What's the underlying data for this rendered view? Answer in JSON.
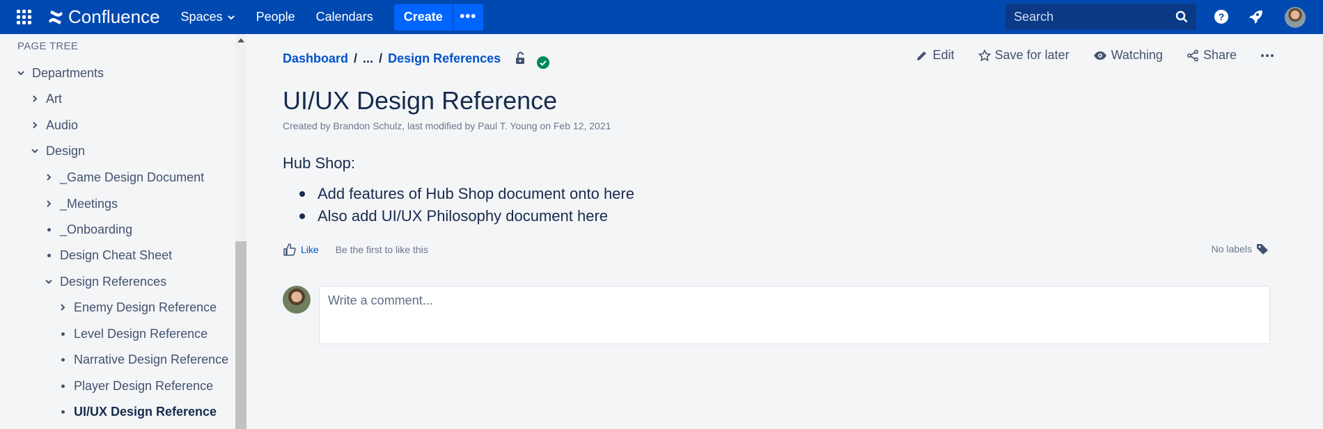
{
  "topnav": {
    "logo_text": "Confluence",
    "spaces_label": "Spaces",
    "people_label": "People",
    "calendars_label": "Calendars",
    "create_label": "Create",
    "more_label": "•••",
    "search_placeholder": "Search"
  },
  "sidebar": {
    "heading": "PAGE TREE",
    "items": [
      {
        "label": "Departments",
        "marker": "chevron-down"
      },
      {
        "label": "Art",
        "marker": "chevron-right"
      },
      {
        "label": "Audio",
        "marker": "chevron-right"
      },
      {
        "label": "Design",
        "marker": "chevron-down"
      },
      {
        "label": "_Game Design Document",
        "marker": "chevron-right"
      },
      {
        "label": "_Meetings",
        "marker": "chevron-right"
      },
      {
        "label": "_Onboarding",
        "marker": "bullet"
      },
      {
        "label": "Design Cheat Sheet",
        "marker": "bullet"
      },
      {
        "label": "Design References",
        "marker": "chevron-down"
      },
      {
        "label": "Enemy Design Reference",
        "marker": "chevron-right"
      },
      {
        "label": "Level Design Reference",
        "marker": "bullet"
      },
      {
        "label": "Narrative Design Reference",
        "marker": "bullet"
      },
      {
        "label": "Player Design Reference",
        "marker": "bullet"
      },
      {
        "label": "UI/UX Design Reference",
        "marker": "bullet",
        "current": true
      }
    ]
  },
  "breadcrumb": {
    "root": "Dashboard",
    "ellipsis": "...",
    "separator": "/",
    "parent": "Design References"
  },
  "actions": {
    "edit": "Edit",
    "save_for_later": "Save for later",
    "watching": "Watching",
    "share": "Share"
  },
  "page": {
    "title": "UI/UX Design Reference",
    "byline": "Created by Brandon Schulz, last modified by Paul T. Young on Feb 12, 2021",
    "section_heading": "Hub Shop:",
    "bullets": [
      "Add features of Hub Shop document onto here",
      "Also add UI/UX Philosophy document here"
    ]
  },
  "footer": {
    "like_label": "Like",
    "like_text": "Be the first to like this",
    "labels_text": "No labels",
    "comment_placeholder": "Write a comment..."
  },
  "colors": {
    "topnav_bg": "#0049b0",
    "create_button": "#0065ff",
    "link": "#0052cc",
    "success": "#00875a",
    "page_bg": "#f4f5f7"
  }
}
